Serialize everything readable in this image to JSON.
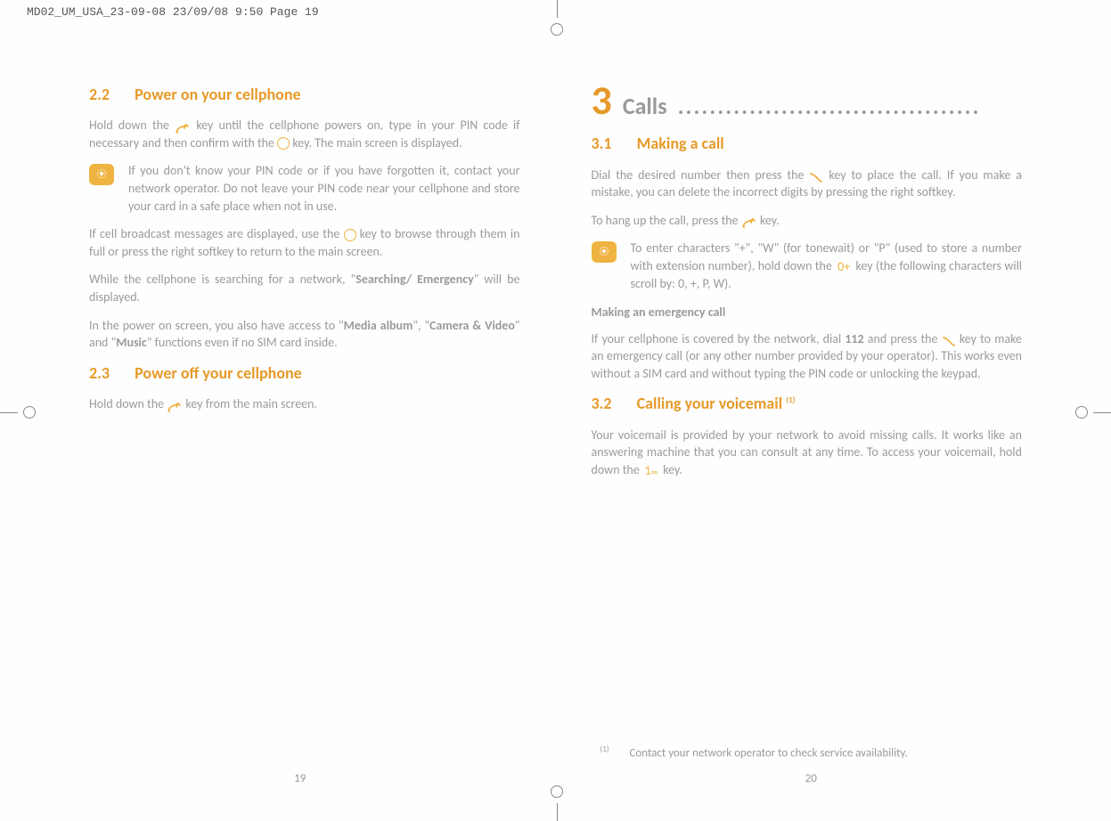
{
  "header": "MD02_UM_USA_23-09-08  23/09/08  9:50  Page 19",
  "left": {
    "s22_num": "2.2",
    "s22_title": "Power on your cellphone",
    "s22_p1a": "Hold down the ",
    "s22_p1b": " key until the cellphone powers on, type in your PIN code if necessary and then confirm with the ",
    "s22_p1c": " key. The main screen is displayed.",
    "s22_tip": "If you don't know your PIN code or if you have forgotten it, contact your network operator. Do not leave your PIN code near your cellphone and store your card in a safe place when not in use.",
    "s22_p2a": "If cell broadcast messages are displayed, use the ",
    "s22_p2b": " key to browse through them in full or press the right softkey to return to the main screen.",
    "s22_p3a": "While the cellphone is searching for a network, \"",
    "s22_p3_bold1": "Searching/ Emergency",
    "s22_p3b": "\" will be displayed.",
    "s22_p4a": "In the power on screen, you also have access to \"",
    "s22_p4_bold1": "Media album",
    "s22_p4b": "\", \"",
    "s22_p4_bold2": "Camera & Video",
    "s22_p4c": "\" and \"",
    "s22_p4_bold3": "Music",
    "s22_p4d": "\" functions even if no SIM card inside.",
    "s23_num": "2.3",
    "s23_title": "Power off your cellphone",
    "s23_p1a": "Hold down the ",
    "s23_p1b": " key from the main screen.",
    "pagenum": "19"
  },
  "right": {
    "chapter_num": "3",
    "chapter_title": "Calls",
    "chapter_dots": "......................................",
    "s31_num": "3.1",
    "s31_title": "Making a call",
    "s31_p1a": "Dial the desired number then press the ",
    "s31_p1b": " key to place the call. If you make a mistake, you can delete the incorrect digits by pressing the right softkey.",
    "s31_p2a": "To hang up the call, press the ",
    "s31_p2b": " key.",
    "s31_tip_a": "To enter characters \"+\", \"W\" (for tonewait) or \"P\" (used to store a number with extension number), hold down the ",
    "s31_tip_key": "0+",
    "s31_tip_b": " key (the following characters will scroll by: 0, +, P, W).",
    "s31_sub": "Making an emergency call",
    "s31_p3a": "If your cellphone is covered by the network, dial ",
    "s31_p3_bold": "112",
    "s31_p3b": " and press the ",
    "s31_p3c": " key to make an emergency call (or any other number provided by your operator). This works even without a SIM card and without typing the PIN code or unlocking the keypad.",
    "s32_num": "3.2",
    "s32_title_a": "Calling your voicemail ",
    "s32_title_sup": "(1)",
    "s32_p1a": "Your voicemail is provided by your network to avoid missing calls. It works like an answering machine that you can consult at any time. To access your voicemail, hold down the ",
    "s32_p1_key": "1",
    "s32_p1b": " key.",
    "footnote_sup": "(1)",
    "footnote": "Contact your network operator to check service availability.",
    "pagenum": "20"
  }
}
